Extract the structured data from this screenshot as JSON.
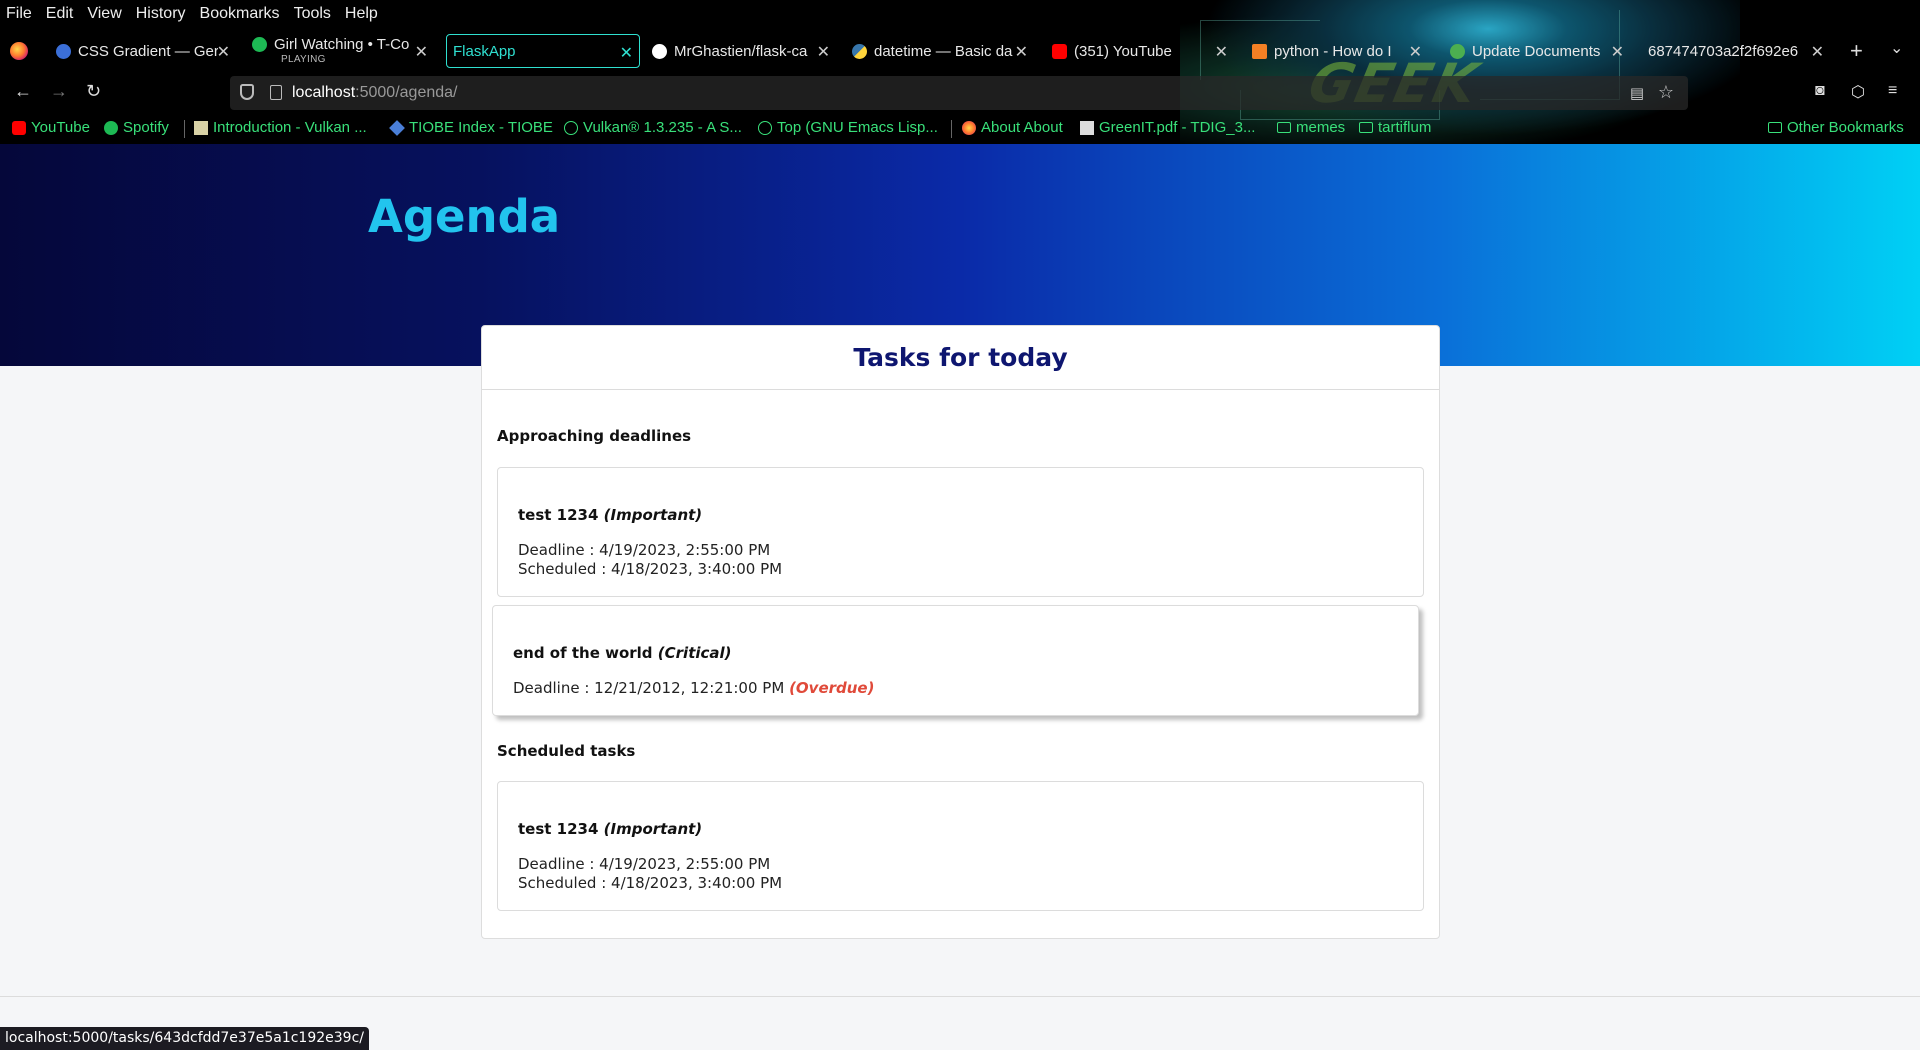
{
  "browser": {
    "menu": [
      "File",
      "Edit",
      "View",
      "History",
      "Bookmarks",
      "Tools",
      "Help"
    ],
    "tabs": [
      {
        "title": "CSS Gradient — Ger",
        "icon_color": "#3b6fd8"
      },
      {
        "title": "Girl Watching • T-Co",
        "sub": "PLAYING",
        "icon_color": "#1db954"
      },
      {
        "title": "FlaskApp",
        "active": true
      },
      {
        "title": "MrGhastien/flask-ca",
        "icon_color": "#ffffff"
      },
      {
        "title": "datetime — Basic da",
        "icon_color": "#3776ab"
      },
      {
        "title": "(351) YouTube",
        "icon_color": "#ff0000"
      },
      {
        "title": "python - How do I",
        "icon_color": "#f48024"
      },
      {
        "title": "Update Documents",
        "icon_color": "#4caf50"
      },
      {
        "title": "687474703a2f2f692e6",
        "icon_color": "#888888"
      }
    ],
    "url_host": "localhost",
    "url_path": ":5000/agenda/",
    "bookmarks": [
      {
        "label": "YouTube",
        "icon_color": "#ff0000"
      },
      {
        "label": "Spotify",
        "icon_color": "#1db954"
      },
      {
        "label": "Introduction - Vulkan ...",
        "icon_color": "#d9d2a6"
      },
      {
        "label": "TIOBE Index - TIOBE",
        "icon_color": "#4a7fd8"
      },
      {
        "label": "Vulkan® 1.3.235 - A S...",
        "icon_color": "#39e07a"
      },
      {
        "label": "Top (GNU Emacs Lisp...",
        "icon_color": "#39e07a"
      },
      {
        "label": "About About",
        "icon_color": "#ff7a2f"
      },
      {
        "label": "GreenIT.pdf - TDIG_3...",
        "icon_color": "#dddddd"
      },
      {
        "label": "memes",
        "icon_color": "#39e07a"
      },
      {
        "label": "tartiflum",
        "icon_color": "#39e07a"
      }
    ],
    "other_bookmarks": "Other Bookmarks",
    "status_url": "localhost:5000/tasks/643dcfdd7e37e5a1c192e39c/"
  },
  "page": {
    "title": "Agenda",
    "card_title": "Tasks for today",
    "sections": {
      "approaching": "Approaching deadlines",
      "scheduled": "Scheduled tasks"
    },
    "approaching_tasks": [
      {
        "name": "test 1234",
        "priority": "(Important)",
        "deadline": "Deadline : 4/19/2023, 2:55:00 PM",
        "scheduled": "Scheduled : 4/18/2023, 3:40:00 PM"
      },
      {
        "name": "end of the world",
        "priority": "(Critical)",
        "deadline": "Deadline : 12/21/2012, 12:21:00 PM",
        "overdue": "(Overdue)"
      }
    ],
    "scheduled_tasks": [
      {
        "name": "test 1234",
        "priority": "(Important)",
        "deadline": "Deadline : 4/19/2023, 2:55:00 PM",
        "scheduled": "Scheduled : 4/18/2023, 3:40:00 PM"
      }
    ]
  },
  "colors": {
    "accent_tab": "#2fe0d0",
    "heading": "#22c4ee",
    "card_title": "#0e1670",
    "overdue": "#e04a3a"
  }
}
